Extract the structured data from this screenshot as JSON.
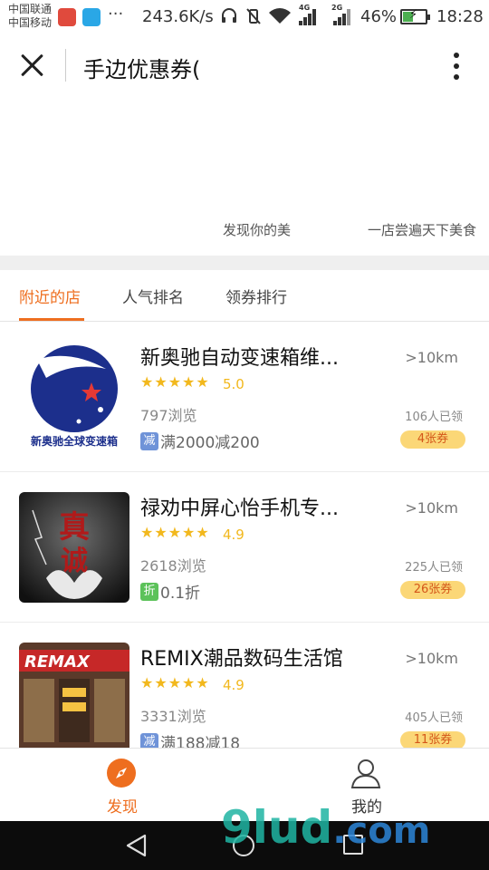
{
  "status_bar": {
    "carrier1": "中国联通",
    "carrier2": "中国移动",
    "dots": "···",
    "speed": "243.6K/s",
    "net1": "4G",
    "net2": "2G",
    "battery": "46%",
    "battery_level": 0.46,
    "time": "18:28"
  },
  "nav": {
    "title": "手边优惠券("
  },
  "banner": {
    "caption_1": "发现你的美",
    "caption_2": "一店尝遍天下美食"
  },
  "tabs": [
    {
      "label": "附近的店",
      "active": true
    },
    {
      "label": "人气排名",
      "active": false
    },
    {
      "label": "领券排行",
      "active": false
    }
  ],
  "shops": [
    {
      "name": "新奥驰自动变速箱维...",
      "stars": "★★★★★",
      "rating": "5.0",
      "views": "797浏览",
      "deal_badge": "减",
      "deal_text": "满2000减200",
      "distance": ">10km",
      "claimed": "106人已领",
      "coupons": "4张券",
      "logo_text": "新奥驰全球变速箱"
    },
    {
      "name": "禄劝中屏心怡手机专...",
      "stars": "★★★★★",
      "rating": "4.9",
      "views": "2618浏览",
      "deal_badge": "折",
      "deal_text": "0.1折",
      "distance": ">10km",
      "claimed": "225人已领",
      "coupons": "26张券",
      "logo_text_1": "真",
      "logo_text_2": "诚"
    },
    {
      "name": "REMIX潮品数码生活馆",
      "stars": "★★★★★",
      "rating": "4.9",
      "views": "3331浏览",
      "deal_badge": "减",
      "deal_text": "满188减18",
      "distance": ">10km",
      "claimed": "405人已领",
      "coupons": "11张券",
      "logo_text": "REMAX"
    }
  ],
  "bottom_nav": {
    "discover": "发现",
    "mine": "我的"
  },
  "watermark": {
    "main": "9lud",
    "suffix": ".com"
  },
  "colors": {
    "accent": "#ee6e1f",
    "star": "#f2b81d",
    "coupon_bg": "#fbd777",
    "badge_reduce": "#6f93d8",
    "badge_discount": "#5cc25a"
  },
  "icons": {
    "close": "close-icon",
    "more": "more-vertical-icon",
    "discover": "compass-icon",
    "mine": "user-icon"
  }
}
